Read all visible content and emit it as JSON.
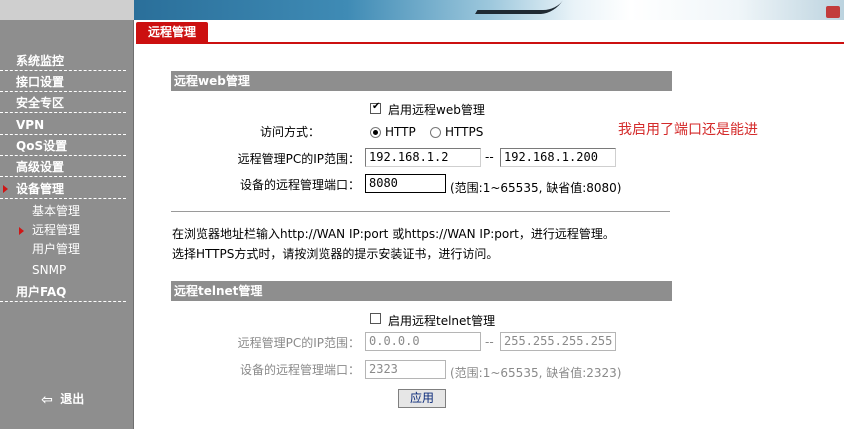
{
  "sidebar": {
    "items": [
      {
        "label": "系统监控"
      },
      {
        "label": "接口设置"
      },
      {
        "label": "安全专区"
      },
      {
        "label": "VPN"
      },
      {
        "label": "QoS设置"
      },
      {
        "label": "高级设置"
      },
      {
        "label": "设备管理"
      }
    ],
    "sub_items": [
      {
        "label": "基本管理"
      },
      {
        "label": "远程管理"
      },
      {
        "label": "用户管理"
      },
      {
        "label": "SNMP"
      }
    ],
    "faq": "用户FAQ",
    "logout": "退出"
  },
  "tab": {
    "label": "远程管理"
  },
  "web": {
    "header": "远程web管理",
    "enable_label": "启用远程web管理",
    "enabled": true,
    "access_label": "访问方式：",
    "http_label": "HTTP",
    "https_label": "HTTPS",
    "selected": "HTTP",
    "ip_range_label": "远程管理PC的IP范围：",
    "ip_start": "192.168.1.2",
    "ip_end": "192.168.1.200",
    "range_dash": "--",
    "port_label": "设备的远程管理端口：",
    "port": "8080",
    "port_hint": "(范围:1~65535, 缺省值:8080)"
  },
  "notes": {
    "line1": "在浏览器地址栏输入http://WAN IP:port 或https://WAN IP:port，进行远程管理。",
    "line2": "选择HTTPS方式时，请按浏览器的提示安装证书，进行访问。"
  },
  "annotation": "我启用了端口还是能进",
  "telnet": {
    "header": "远程telnet管理",
    "enable_label": "启用远程telnet管理",
    "enabled": false,
    "ip_range_label": "远程管理PC的IP范围：",
    "ip_start": "0.0.0.0",
    "ip_end": "255.255.255.255",
    "range_dash": "--",
    "port_label": "设备的远程管理端口：",
    "port": "2323",
    "port_hint": "(范围:1~65535, 缺省值:2323)"
  },
  "apply_button": "应用",
  "colors": {
    "accent": "#cc1010",
    "sidebar": "#8e8e8e",
    "annotation": "#d42a2a"
  }
}
